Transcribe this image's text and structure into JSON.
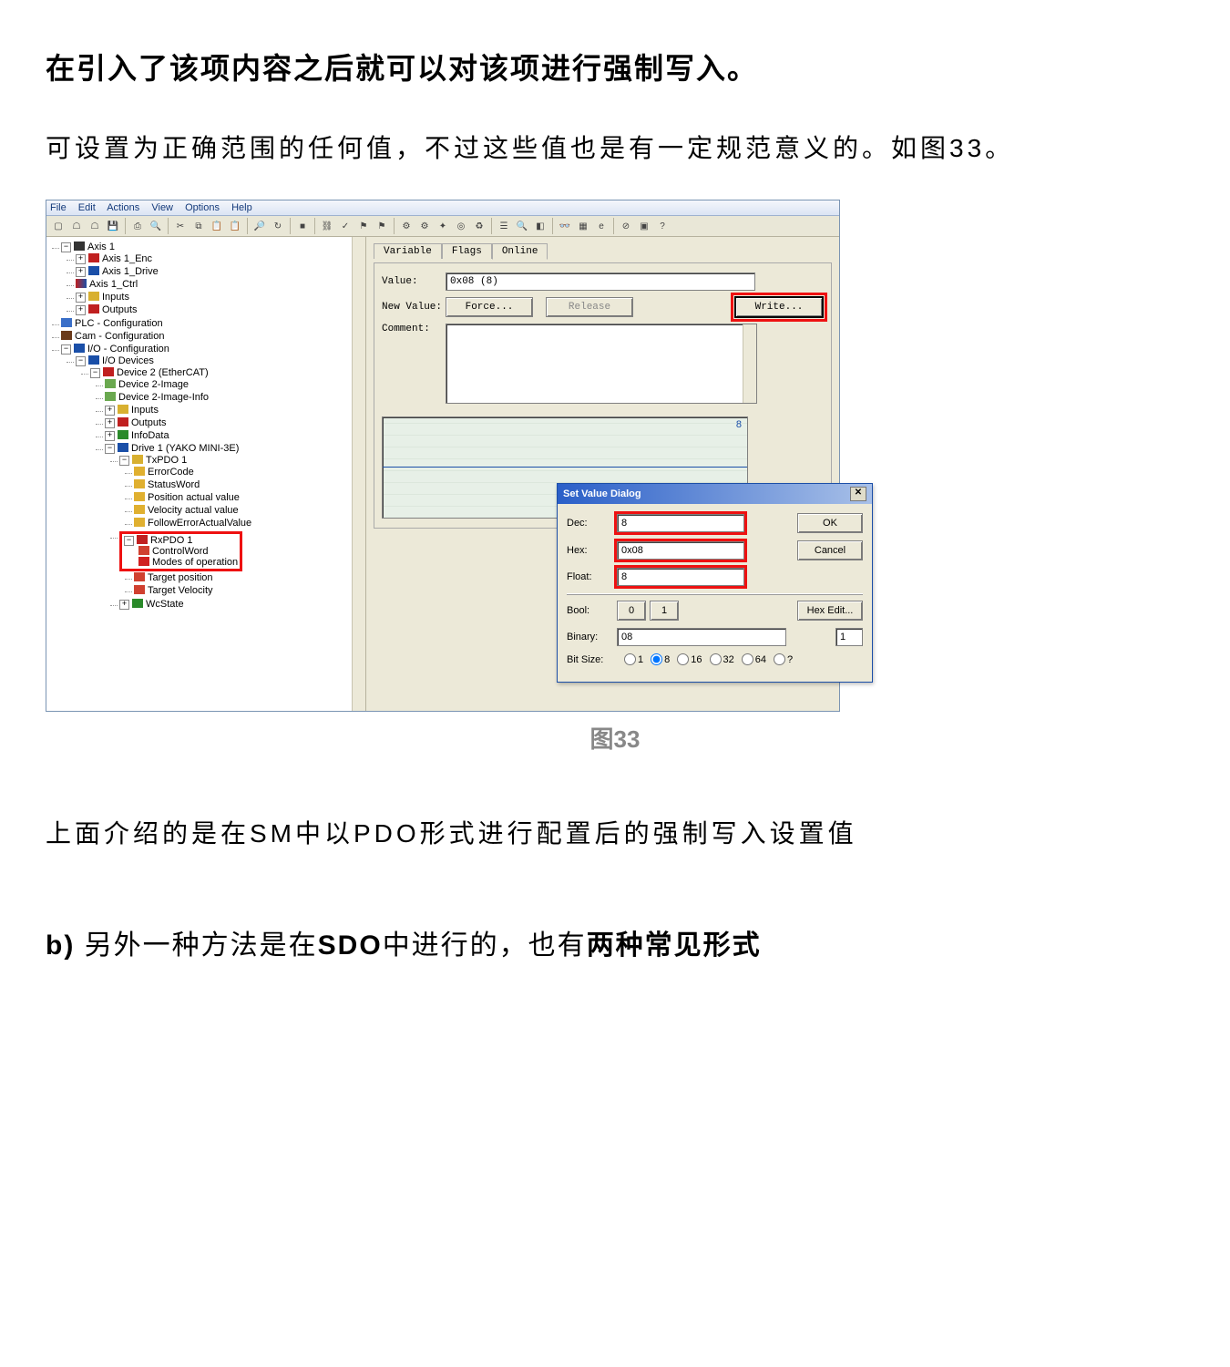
{
  "doc": {
    "heading": "在引入了该项内容之后就可以对该项进行强制写入。",
    "para1": "可设置为正确范围的任何值，不过这些值也是有一定规范意义的。如图33。",
    "caption": "图33",
    "para2": "上面介绍的是在SM中以PDO形式进行配置后的强制写入设置值",
    "secB_prefix": "b)",
    "secB_t1": "另外一种方法是在",
    "secB_sdo": "SDO",
    "secB_t2": "中进行的，也有",
    "secB_t3": "两种常见形式"
  },
  "app": {
    "menu": {
      "file": "File",
      "edit": "Edit",
      "actions": "Actions",
      "view": "View",
      "options": "Options",
      "help": "Help"
    },
    "toolbar_hint": "?",
    "tree": {
      "axis1": "Axis 1",
      "axis1_enc": "Axis 1_Enc",
      "axis1_drive": "Axis 1_Drive",
      "axis1_ctrl": "Axis 1_Ctrl",
      "inputs": "Inputs",
      "outputs": "Outputs",
      "plc": "PLC - Configuration",
      "cam": "Cam - Configuration",
      "ioconf": "I/O - Configuration",
      "iodev": "I/O Devices",
      "dev2": "Device 2 (EtherCAT)",
      "dev2img": "Device 2-Image",
      "dev2imginfo": "Device 2-Image-Info",
      "infodata": "InfoData",
      "drive1": "Drive 1 (YAKO MINI-3E)",
      "txpdo1": "TxPDO 1",
      "errorcode": "ErrorCode",
      "statusword": "StatusWord",
      "posactual": "Position actual value",
      "velactual": "Velocity actual value",
      "followerr": "FollowErrorActualValue",
      "rxpdo1": "RxPDO 1",
      "controlword": "ControlWord",
      "modesop": "Modes of operation",
      "targetpos": "Target position",
      "targetvel": "Target Velocity",
      "wcstate": "WcState"
    },
    "tabs": {
      "variable": "Variable",
      "flags": "Flags",
      "online": "Online"
    },
    "panel": {
      "value_lbl": "Value:",
      "value_val": "0x08 (8)",
      "newvalue_lbl": "New Value:",
      "force": "Force...",
      "release": "Release",
      "write": "Write...",
      "comment_lbl": "Comment:",
      "graph_eight": "8"
    }
  },
  "dialog": {
    "title": "Set Value Dialog",
    "dec_lbl": "Dec:",
    "dec_val": "8",
    "hex_lbl": "Hex:",
    "hex_val": "0x08",
    "float_lbl": "Float:",
    "float_val": "8",
    "bool_lbl": "Bool:",
    "b0": "0",
    "b1": "1",
    "binary_lbl": "Binary:",
    "binary_val": "08",
    "binary_width": "1",
    "bitsize_lbl": "Bit Size:",
    "bits": {
      "b1": "1",
      "b8": "8",
      "b16": "16",
      "b32": "32",
      "b64": "64",
      "bq": "?"
    },
    "ok": "OK",
    "cancel": "Cancel",
    "hexedit": "Hex Edit..."
  }
}
